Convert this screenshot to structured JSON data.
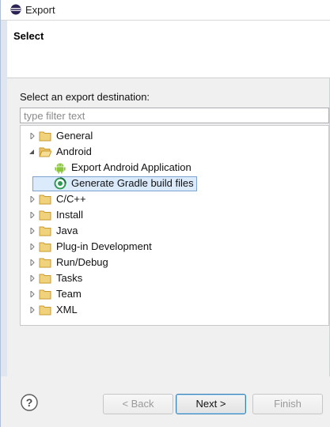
{
  "window": {
    "title": "Export"
  },
  "header": {
    "title": "Select"
  },
  "body": {
    "destination_label": "Select an export destination:",
    "filter_placeholder": "type filter text"
  },
  "tree": {
    "items": [
      {
        "label": "General",
        "expanded": false,
        "depth": 0,
        "icon": "folder-icon"
      },
      {
        "label": "Android",
        "expanded": true,
        "depth": 0,
        "icon": "folder-icon"
      },
      {
        "label": "Export Android Application",
        "depth": 1,
        "icon": "android-icon"
      },
      {
        "label": "Generate Gradle build files",
        "depth": 1,
        "icon": "gradle-icon",
        "selected": true
      },
      {
        "label": "C/C++",
        "expanded": false,
        "depth": 0,
        "icon": "folder-icon"
      },
      {
        "label": "Install",
        "expanded": false,
        "depth": 0,
        "icon": "folder-icon"
      },
      {
        "label": "Java",
        "expanded": false,
        "depth": 0,
        "icon": "folder-icon"
      },
      {
        "label": "Plug-in Development",
        "expanded": false,
        "depth": 0,
        "icon": "folder-icon"
      },
      {
        "label": "Run/Debug",
        "expanded": false,
        "depth": 0,
        "icon": "folder-icon"
      },
      {
        "label": "Tasks",
        "expanded": false,
        "depth": 0,
        "icon": "folder-icon"
      },
      {
        "label": "Team",
        "expanded": false,
        "depth": 0,
        "icon": "folder-icon"
      },
      {
        "label": "XML",
        "expanded": false,
        "depth": 0,
        "icon": "folder-icon"
      }
    ]
  },
  "footer": {
    "back_label": "< Back",
    "next_label": "Next >",
    "finish_label": "Finish"
  },
  "colors": {
    "selection_bg": "#dcebfc",
    "selection_border": "#7da2ce",
    "folder": "#e8c36a",
    "android_green": "#8cc63f"
  }
}
